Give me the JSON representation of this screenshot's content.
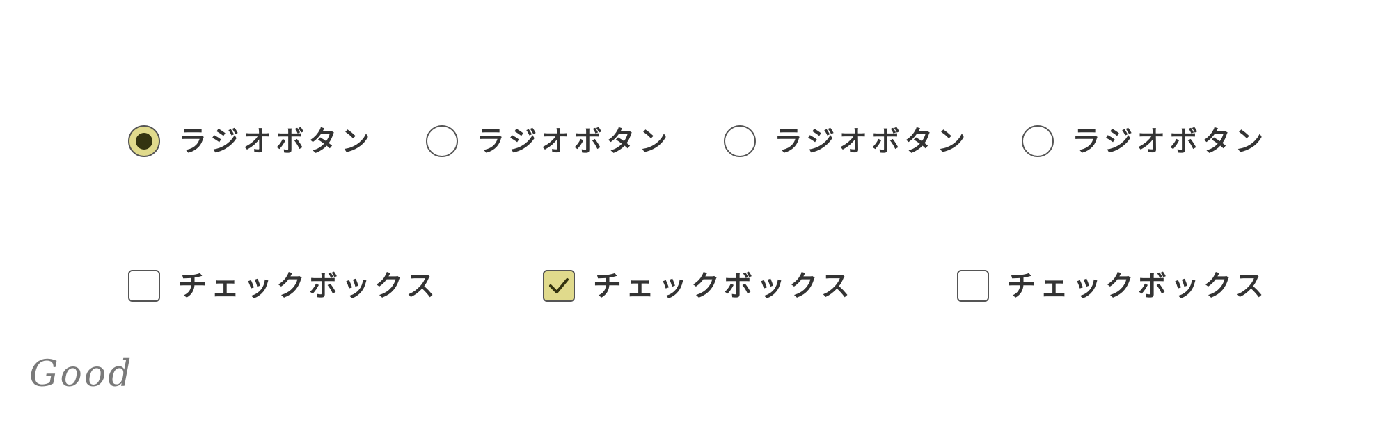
{
  "radio_group": {
    "options": [
      {
        "label": "ラジオボタン",
        "checked": true
      },
      {
        "label": "ラジオボタン",
        "checked": false
      },
      {
        "label": "ラジオボタン",
        "checked": false
      },
      {
        "label": "ラジオボタン",
        "checked": false
      }
    ]
  },
  "checkbox_group": {
    "options": [
      {
        "label": "チェックボックス",
        "checked": false
      },
      {
        "label": "チェックボックス",
        "checked": true
      },
      {
        "label": "チェックボックス",
        "checked": false
      }
    ]
  },
  "caption": "Good",
  "colors": {
    "accent_fill": "#e0da8c",
    "indicator": "#333310",
    "border": "#555555",
    "text": "#333333",
    "caption": "#7a7a7a"
  },
  "icons": {
    "check": "check-icon"
  }
}
